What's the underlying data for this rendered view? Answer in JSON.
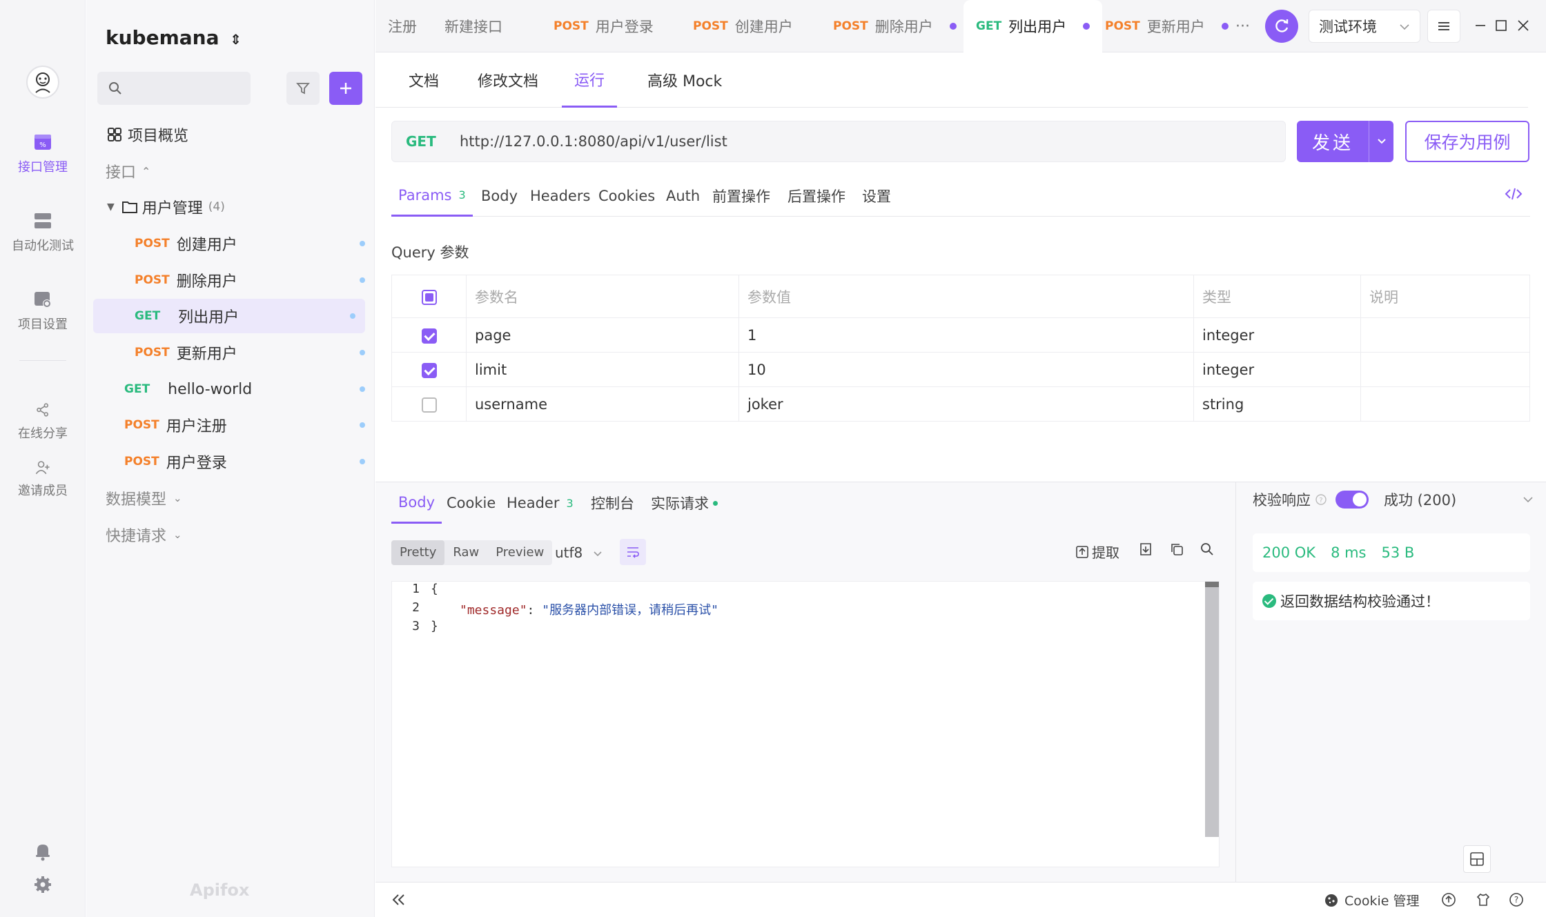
{
  "rail": {
    "items": [
      {
        "label": "接口管理",
        "icon": "api-management-icon"
      },
      {
        "label": "自动化测试",
        "icon": "automation-test-icon"
      },
      {
        "label": "项目设置",
        "icon": "project-settings-icon"
      },
      {
        "label": "在线分享",
        "icon": "share-icon"
      },
      {
        "label": "邀请成员",
        "icon": "invite-member-icon"
      }
    ]
  },
  "sidebar": {
    "project_name": "kubemana",
    "overview": "项目概览",
    "section_api": "接口",
    "folder": {
      "name": "用户管理",
      "count": "(4)"
    },
    "endpoints": [
      {
        "method": "POST",
        "name": "创建用户"
      },
      {
        "method": "POST",
        "name": "删除用户"
      },
      {
        "method": "GET",
        "name": "列出用户"
      },
      {
        "method": "POST",
        "name": "更新用户"
      }
    ],
    "root_endpoints": [
      {
        "method": "GET",
        "name": "hello-world"
      },
      {
        "method": "POST",
        "name": "用户注册"
      },
      {
        "method": "POST",
        "name": "用户登录"
      }
    ],
    "data_model": "数据模型",
    "quick_request": "快捷请求",
    "brand": "Apifox"
  },
  "tabs": [
    {
      "method": "",
      "name": "注册"
    },
    {
      "method": "",
      "name": "新建接口"
    },
    {
      "method": "POST",
      "name": "用户登录"
    },
    {
      "method": "POST",
      "name": "创建用户"
    },
    {
      "method": "POST",
      "name": "删除用户"
    },
    {
      "method": "GET",
      "name": "列出用户"
    },
    {
      "method": "POST",
      "name": "更新用户"
    }
  ],
  "more": "···",
  "environment": "测试环境",
  "subtabs": [
    "文档",
    "修改文档",
    "运行",
    "高级 Mock"
  ],
  "request": {
    "method": "GET",
    "url": "http://127.0.0.1:8080/api/v1/user/list",
    "send": "发送",
    "save_case": "保存为用例"
  },
  "request_tabs": {
    "params": "Params",
    "params_count": "3",
    "body": "Body",
    "headers": "Headers",
    "cookies": "Cookies",
    "auth": "Auth",
    "pre": "前置操作",
    "post": "后置操作",
    "settings": "设置"
  },
  "query": {
    "title": "Query 参数",
    "columns": [
      "参数名",
      "参数值",
      "类型",
      "说明"
    ],
    "rows": [
      {
        "name": "page",
        "value": "1",
        "type": "integer",
        "desc": "",
        "checked": true
      },
      {
        "name": "limit",
        "value": "10",
        "type": "integer",
        "desc": "",
        "checked": true
      },
      {
        "name": "username",
        "value": "joker",
        "type": "string",
        "desc": "",
        "checked": false
      }
    ]
  },
  "response": {
    "tabs": {
      "body": "Body",
      "cookie": "Cookie",
      "header": "Header",
      "header_count": "3",
      "console": "控制台",
      "actual": "实际请求"
    },
    "view_modes": [
      "Pretty",
      "Raw",
      "Preview"
    ],
    "encoding": "utf8",
    "extract": "提取",
    "lines": [
      "1",
      "2",
      "3"
    ],
    "code_open": "{",
    "code_key": "\"message\"",
    "code_sep": ": ",
    "code_value": "\"服务器内部错误，请稍后再试\"",
    "code_close": "}",
    "verify_label": "校验响应",
    "verify_result": "成功 (200)",
    "status": "200 OK",
    "time": "8 ms",
    "size": "53 B",
    "check_msg": "返回数据结构校验通过！"
  },
  "footer": {
    "cookie_mgr": "Cookie 管理"
  }
}
